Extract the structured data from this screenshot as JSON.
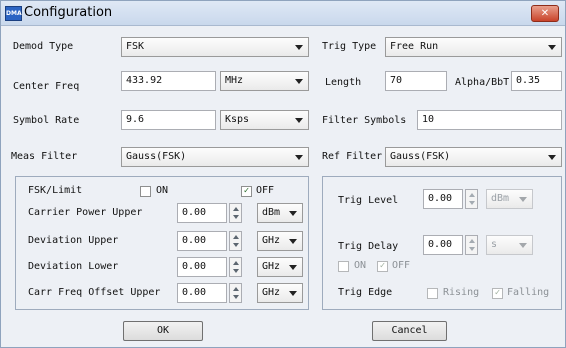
{
  "window": {
    "title": "Configuration",
    "app_icon_text": "DMA"
  },
  "demod_type": {
    "label": "Demod Type",
    "value": "FSK"
  },
  "trig_type": {
    "label": "Trig Type",
    "value": "Free Run"
  },
  "center_freq": {
    "label": "Center Freq",
    "value": "433.92",
    "unit": "MHz"
  },
  "length": {
    "label": "Length",
    "value": "70"
  },
  "alpha_bbt": {
    "label": "Alpha/BbT",
    "value": "0.35"
  },
  "symbol_rate": {
    "label": "Symbol Rate",
    "value": "9.6",
    "unit": "Ksps"
  },
  "filter_symbols": {
    "label": "Filter Symbols",
    "value": "10"
  },
  "meas_filter": {
    "label": "Meas Filter",
    "value": "Gauss(FSK)"
  },
  "ref_filter": {
    "label": "Ref Filter",
    "value": "Gauss(FSK)"
  },
  "fsk_limit": {
    "label": "FSK/Limit",
    "on_label": "ON",
    "on_checked": false,
    "off_label": "OFF",
    "off_checked": true,
    "rows": [
      {
        "label": "Carrier Power Upper",
        "value": "0.00",
        "unit": "dBm"
      },
      {
        "label": "Deviation Upper",
        "value": "0.00",
        "unit": "GHz"
      },
      {
        "label": "Deviation Lower",
        "value": "0.00",
        "unit": "GHz"
      },
      {
        "label": "Carr Freq Offset Upper",
        "value": "0.00",
        "unit": "GHz"
      }
    ]
  },
  "trig_level": {
    "label": "Trig Level",
    "value": "0.00",
    "unit": "dBm"
  },
  "trig_delay": {
    "label": "Trig Delay",
    "value": "0.00",
    "unit": "s",
    "on_label": "ON",
    "on_checked": false,
    "off_label": "OFF",
    "off_checked": true
  },
  "trig_edge": {
    "label": "Trig Edge",
    "rising_label": "Rising",
    "rising_checked": false,
    "falling_label": "Falling",
    "falling_checked": true
  },
  "buttons": {
    "ok": "OK",
    "cancel": "Cancel"
  },
  "check_mark": "✓"
}
